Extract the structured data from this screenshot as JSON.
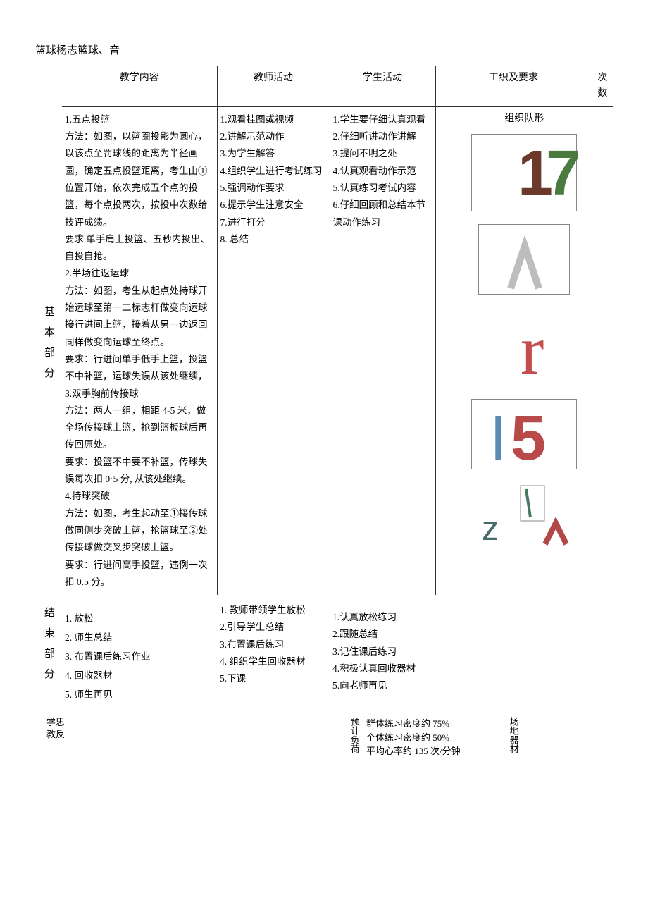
{
  "title_line": "篮球杨志篮球、音",
  "headers": {
    "col1": "教学内容",
    "col2": "教师活动",
    "col3": "学生活动",
    "col4": "工织及要求",
    "col5": "次数"
  },
  "basic_label": "基本部分",
  "basic": {
    "content": "1.五点投篮\n方法：如图，以篮圈投影为圆心，以该点至罚球线的距离为半径画圆，确定五点投篮距离，考生由①位置开始，依次完成五个点的投篮，每个点投两次，按投中次数给技评成绩。\n要求 单手肩上投篮、五秒内投出、自投自抢。\n2.半场往返运球\n方法：如图，考生从起点处持球开始运球至第一二标志杆做变向运球接行进间上篮，接着从另一边返回同样做变向运球至终点。\n要求：行进间单手低手上篮，投篮不中补篮，运球失误从该处继续，\n3.双手胸前传接球\n方法：两人一组，相距 4-5 米，做全场传接球上篮，抢到篮板球后再传回原处。\n要求：投篮不中要不补篮，传球失误每次扣 0·5 分, 从该处继续。\n4.持球突破\n方法：如图，考生起动至①接传球做同侧步突破上篮，抢篮球至②处传接球做交叉步突破上篮。\n要求：行进间高手投篮，违例一次扣 0.5 分。",
    "teacher": "1.观看挂图或视频\n2.讲解示范动作\n3.为学生解答\n4.组织学生进行考试练习\n5.强调动作要求\n6.提示学生注意安全\n7.进行打分\n8. 总结",
    "student": "1.学生要仔细认真观看\n2.仔细听讲动作讲解\n3.提问不明之处\n4.认真观看动作示范\n5.认真练习考试内容\n6.仔细回顾和总结本节课动作练习",
    "org_label": "组织队形"
  },
  "end_label": "结束部分",
  "end": {
    "content": "1. 放松\n2. 师生总结\n3. 布置课后练习作业\n4. 回收器材\n5. 师生再见",
    "teacher": "1. 教师带领学生放松\n2.引导学生总结\n3.布置课后练习\n4. 组织学生回收器材\n5.下课",
    "student": "1.认真放松练习\n2.跟随总结\n3.记住课后练习\n4.积极认真回收器材\n5.向老师再见"
  },
  "footer": {
    "left_label": "学思\n教反",
    "mid_label": "预计负荷",
    "mid_content": "群体练习密度约 75%\n个体练习密度约 50%\n平均心率约 135 次/分钟",
    "right_label": "场地器材"
  }
}
